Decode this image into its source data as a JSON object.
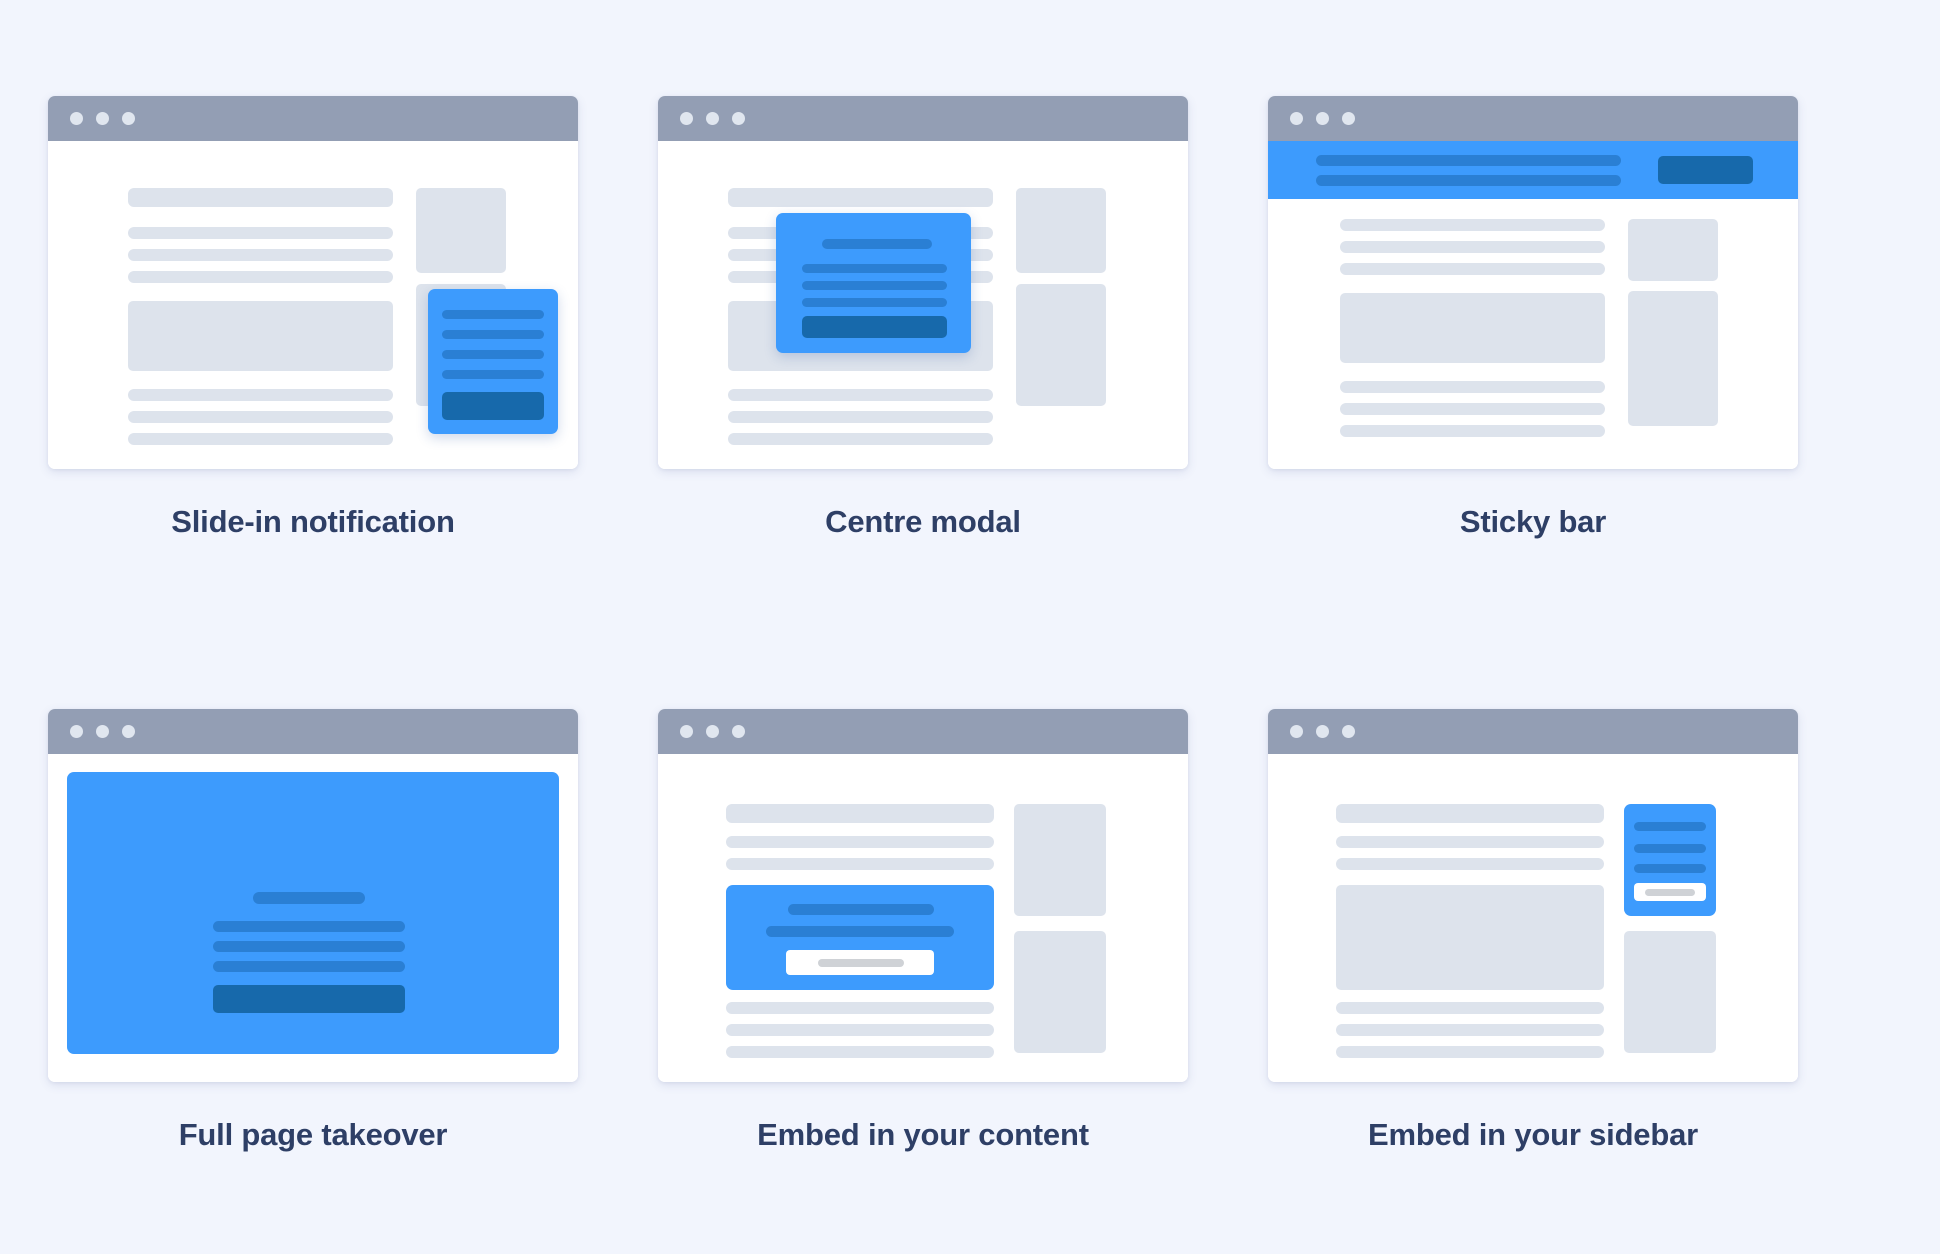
{
  "page": {
    "background_color": "#f2f5fd",
    "caption_color": "#2e3f66",
    "accent_color": "#3d9bfd",
    "accent_dark_color": "#1769ab",
    "accent_mid_color": "#2a7fd4",
    "skeleton_color": "#dde3ec",
    "titlebar_color": "#939eb4",
    "window_color": "#ffffff"
  },
  "cards": [
    {
      "id": "slide-in-notification",
      "caption": "Slide-in notification",
      "window_dots": 3,
      "placement": "bottom-right-corner"
    },
    {
      "id": "centre-modal",
      "caption": "Centre modal",
      "window_dots": 3,
      "placement": "center-overlay"
    },
    {
      "id": "sticky-bar",
      "caption": "Sticky bar",
      "window_dots": 3,
      "placement": "top-full-width-bar"
    },
    {
      "id": "full-page-takeover",
      "caption": "Full page takeover",
      "window_dots": 3,
      "placement": "full-viewport"
    },
    {
      "id": "embed-in-your-content",
      "caption": "Embed in your content",
      "window_dots": 3,
      "placement": "inline-content-block"
    },
    {
      "id": "embed-in-your-sidebar",
      "caption": "Embed in your sidebar",
      "window_dots": 3,
      "placement": "sidebar-widget"
    }
  ]
}
